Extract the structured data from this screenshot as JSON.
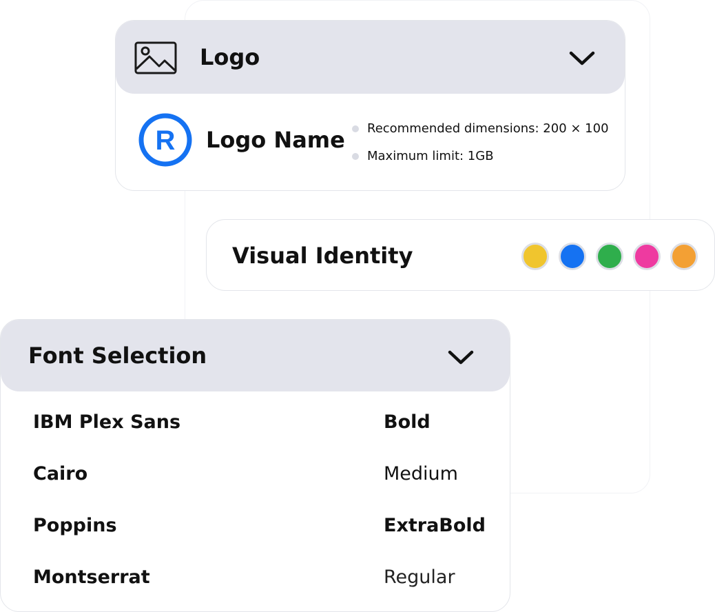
{
  "logo_section": {
    "title": "Logo",
    "logo_name": "Logo Name",
    "logo_mark_letter": "R",
    "requirements": [
      "Recommended dimensions: 200 × 100",
      "Maximum limit: 1GB"
    ],
    "image_icon": "image-icon",
    "toggle_icon": "chevron-down-icon"
  },
  "visual_identity": {
    "title": "Visual Identity",
    "colors": [
      "#f0c52e",
      "#1572f2",
      "#2fae4c",
      "#ee3aa0",
      "#f3a034"
    ]
  },
  "font_selection": {
    "title": "Font Selection",
    "toggle_icon": "chevron-down-icon",
    "fonts": [
      {
        "name": "IBM Plex Sans",
        "weight": "Bold"
      },
      {
        "name": "Cairo",
        "weight": "Medium"
      },
      {
        "name": "Poppins",
        "weight": "ExtraBold"
      },
      {
        "name": "Montserrat",
        "weight": "Regular"
      }
    ]
  },
  "colors": {
    "accent": "#1572f2",
    "header_bg": "#e3e4ec",
    "border": "#e3e5ea"
  }
}
